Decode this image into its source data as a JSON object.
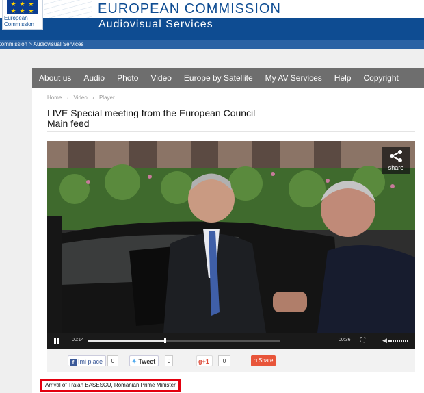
{
  "header": {
    "logo_text_line1": "European",
    "logo_text_line2": "Commission",
    "title": "EUROPEAN COMMISSION",
    "subtitle": "Audiovisual Services"
  },
  "breadcrumb_bar": "Commission > Audiovisual Services",
  "nav": {
    "items": [
      "About us",
      "Audio",
      "Photo",
      "Video",
      "Europe by Satellite",
      "My AV Services",
      "Help",
      "Copyright"
    ]
  },
  "crumbs": [
    "Home",
    "Video",
    "Player"
  ],
  "crumb_separator": "›",
  "page_title_line1": "LIVE Special meeting from the European Council",
  "page_title_line2": "Main feed",
  "player": {
    "share_label": "share",
    "current_time": "00:14",
    "total_time": "00:36",
    "progress_fraction": 0.4
  },
  "social": {
    "facebook_label": "Imi place",
    "facebook_count": "0",
    "tweet_label": "Tweet",
    "tweet_count": "0",
    "gplus_label": "+1",
    "gplus_count": "0",
    "share_label": "Share"
  },
  "caption": "Arrival of Traian BASESCU, Romanian Prime Minister",
  "colors": {
    "brand_blue": "#0e4c92",
    "nav_grey": "#6e6e6e",
    "highlight_red": "#e3000f"
  }
}
